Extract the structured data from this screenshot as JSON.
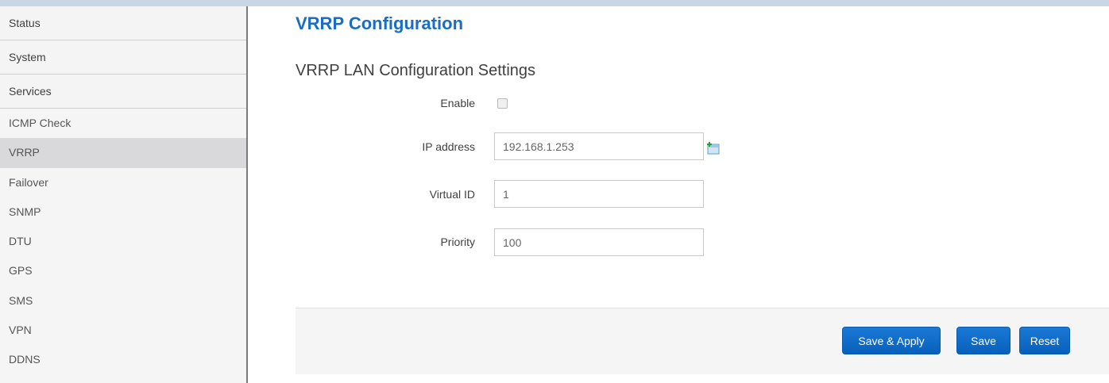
{
  "sidebar": {
    "categories": [
      "Status",
      "System",
      "Services"
    ],
    "items": [
      "ICMP Check",
      "VRRP",
      "Failover",
      "SNMP",
      "DTU",
      "GPS",
      "SMS",
      "VPN",
      "DDNS"
    ],
    "active_item": "VRRP"
  },
  "page": {
    "title": "VRRP Configuration",
    "section_title": "VRRP LAN Configuration Settings"
  },
  "form": {
    "enable_label": "Enable",
    "enable_checked": false,
    "ip_label": "IP address",
    "ip_value": "192.168.1.253",
    "vid_label": "Virtual ID",
    "vid_value": "1",
    "priority_label": "Priority",
    "priority_value": "100",
    "add_icon": "add-entry-icon"
  },
  "actions": {
    "save_apply": "Save & Apply",
    "save": "Save",
    "reset": "Reset"
  },
  "colors": {
    "title": "#1a6dc4",
    "button": "#0a69c7",
    "active_item_bg": "#d9d9dc"
  }
}
